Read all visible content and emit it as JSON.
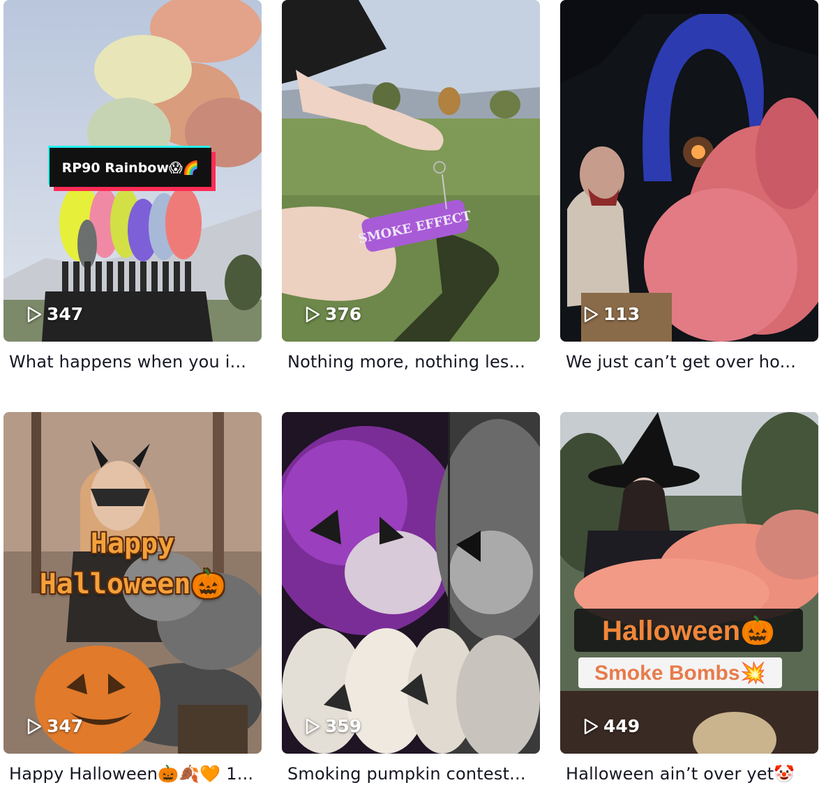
{
  "videos": [
    {
      "plays": "347",
      "caption": "What happens when you i...",
      "overlay": "RP90 Rainbow😱🌈"
    },
    {
      "plays": "376",
      "caption": "Nothing more, nothing les...",
      "overlay": "SMOKE EFFECT"
    },
    {
      "plays": "113",
      "caption": "We just can’t get over ho..."
    },
    {
      "plays": "347",
      "caption": "Happy Halloween🎃🍂🧡 1...",
      "overlay_line1": "Happy",
      "overlay_line2": "Halloween🎃"
    },
    {
      "plays": "359",
      "caption": "Smoking pumpkin contest..."
    },
    {
      "plays": "449",
      "caption": "Halloween ain’t over yet🤡",
      "overlay_line1": "Halloween🎃",
      "overlay_line2": "Smoke Bombs💥"
    }
  ],
  "icons": {
    "play": "play-outline-icon"
  },
  "colors": {
    "caption_text": "#161823",
    "tiktok_red": "#fe2c55",
    "tiktok_cyan": "#25f4ee"
  }
}
